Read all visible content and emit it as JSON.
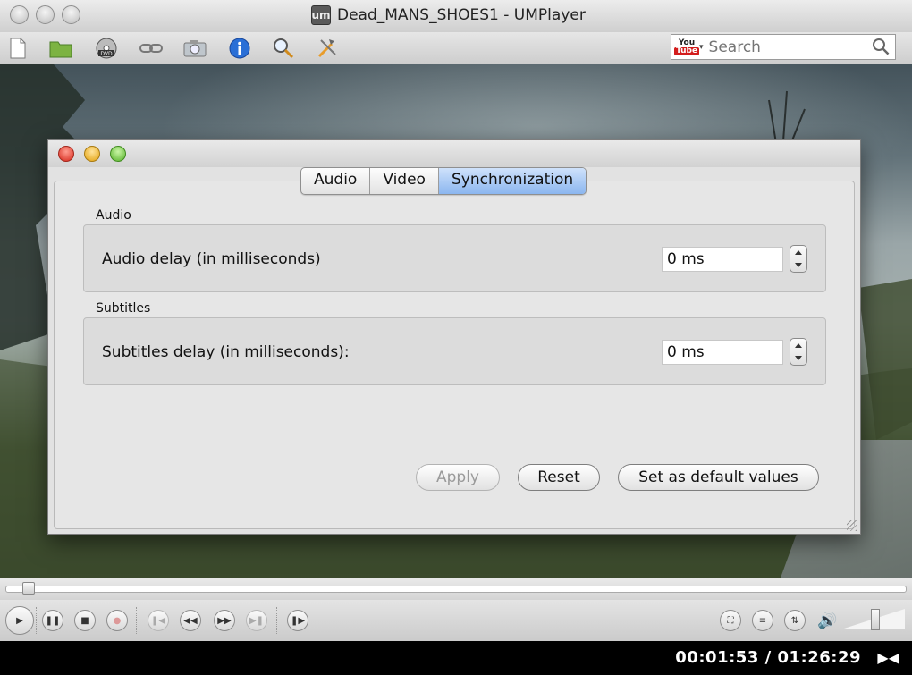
{
  "window": {
    "title": "Dead_MANS_SHOES1 - UMPlayer",
    "app_logo": "um"
  },
  "toolbar": {
    "icons": [
      "new-file-icon",
      "open-folder-icon",
      "dvd-icon",
      "link-icon",
      "camera-icon",
      "info-icon",
      "zoom-icon",
      "tools-icon"
    ],
    "search": {
      "badge_top": "You",
      "badge_bottom": "Tube",
      "placeholder": "Search"
    }
  },
  "dialog": {
    "tabs": [
      {
        "label": "Audio",
        "active": false
      },
      {
        "label": "Video",
        "active": false
      },
      {
        "label": "Synchronization",
        "active": true
      }
    ],
    "audio_group": {
      "title": "Audio",
      "label": "Audio delay (in milliseconds)",
      "value": "0 ms"
    },
    "subtitles_group": {
      "title": "Subtitles",
      "label": "Subtitles delay (in milliseconds):",
      "value": "0 ms"
    },
    "buttons": {
      "apply": "Apply",
      "reset": "Reset",
      "defaults": "Set as default values"
    }
  },
  "playback": {
    "time": "00:01:53 / 01:26:29"
  },
  "colors": {
    "active_tab": "#8bb6ef",
    "volume_icon": "#d88326",
    "close": "#d6281b",
    "minimize": "#e3a20e",
    "zoom": "#58b22b"
  }
}
